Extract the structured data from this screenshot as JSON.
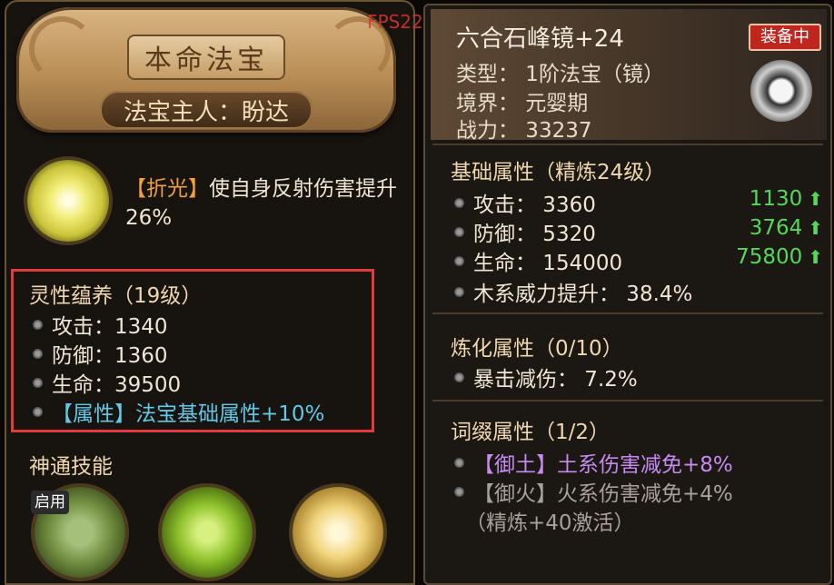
{
  "overlay": {
    "fps": "FPS22"
  },
  "left": {
    "title": "本命法宝",
    "owner": "法宝主人：盼达",
    "skill": {
      "tag": "【折光】",
      "desc": "使自身反射伤害提升26%"
    },
    "nurture": {
      "title": "灵性蕴养（19级）",
      "stats": [
        "攻击：1340",
        "防御：1360",
        "生命：39500"
      ],
      "bonus": "【属性】法宝基础属性+10%"
    },
    "techniques": {
      "title": "神通技能",
      "enabled_badge": "启用"
    }
  },
  "right": {
    "name": "六合石峰镜+24",
    "status_badge": "装备中",
    "type": "类型：  1阶法宝（镜）",
    "realm": "境界：  元婴期",
    "power": "战力：  33237",
    "base": {
      "title": "基础属性（精炼24级）",
      "rows": [
        {
          "label": "攻击：  3360",
          "gain": "1130"
        },
        {
          "label": "防御：  5320",
          "gain": "3764"
        },
        {
          "label": "生命：  154000",
          "gain": "75800"
        }
      ],
      "extra": "木系威力提升：  38.4%"
    },
    "refine": {
      "title": "炼化属性（0/10）",
      "row": "暴击减伤：  7.2%"
    },
    "affix": {
      "title": "词缀属性（1/2）",
      "active": "【御土】土系伤害减免+8%",
      "inactive": "【御火】火系伤害减免+4%",
      "inactive_note": "（精炼+40激活）"
    }
  },
  "colors": {
    "gold": "#f0a23a",
    "blue": "#63c8e8",
    "purple": "#c68af0",
    "green": "#55d858",
    "highlight": "#e23b3b"
  },
  "icons": [
    "skill-orb-icon",
    "mirror-treasure-icon",
    "stat-bullet-icon",
    "stat-up-arrow-icon"
  ]
}
